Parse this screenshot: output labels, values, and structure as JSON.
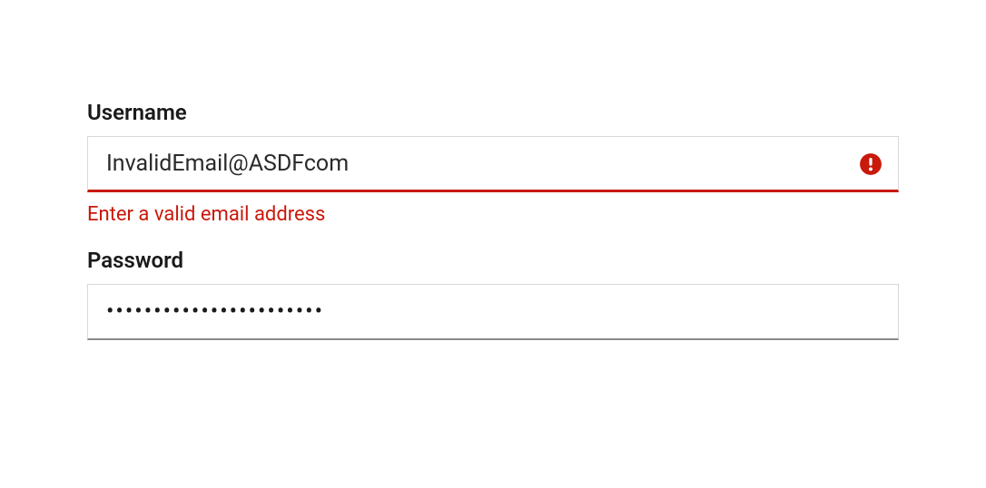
{
  "form": {
    "username": {
      "label": "Username",
      "value": "InvalidEmail@ASDFcom",
      "error_message": "Enter a valid email address"
    },
    "password": {
      "label": "Password",
      "value": "•••••••••••••••••••••••"
    }
  },
  "colors": {
    "error": "#c9190b",
    "text": "#1a1a1a",
    "border": "#d8d8d8"
  }
}
